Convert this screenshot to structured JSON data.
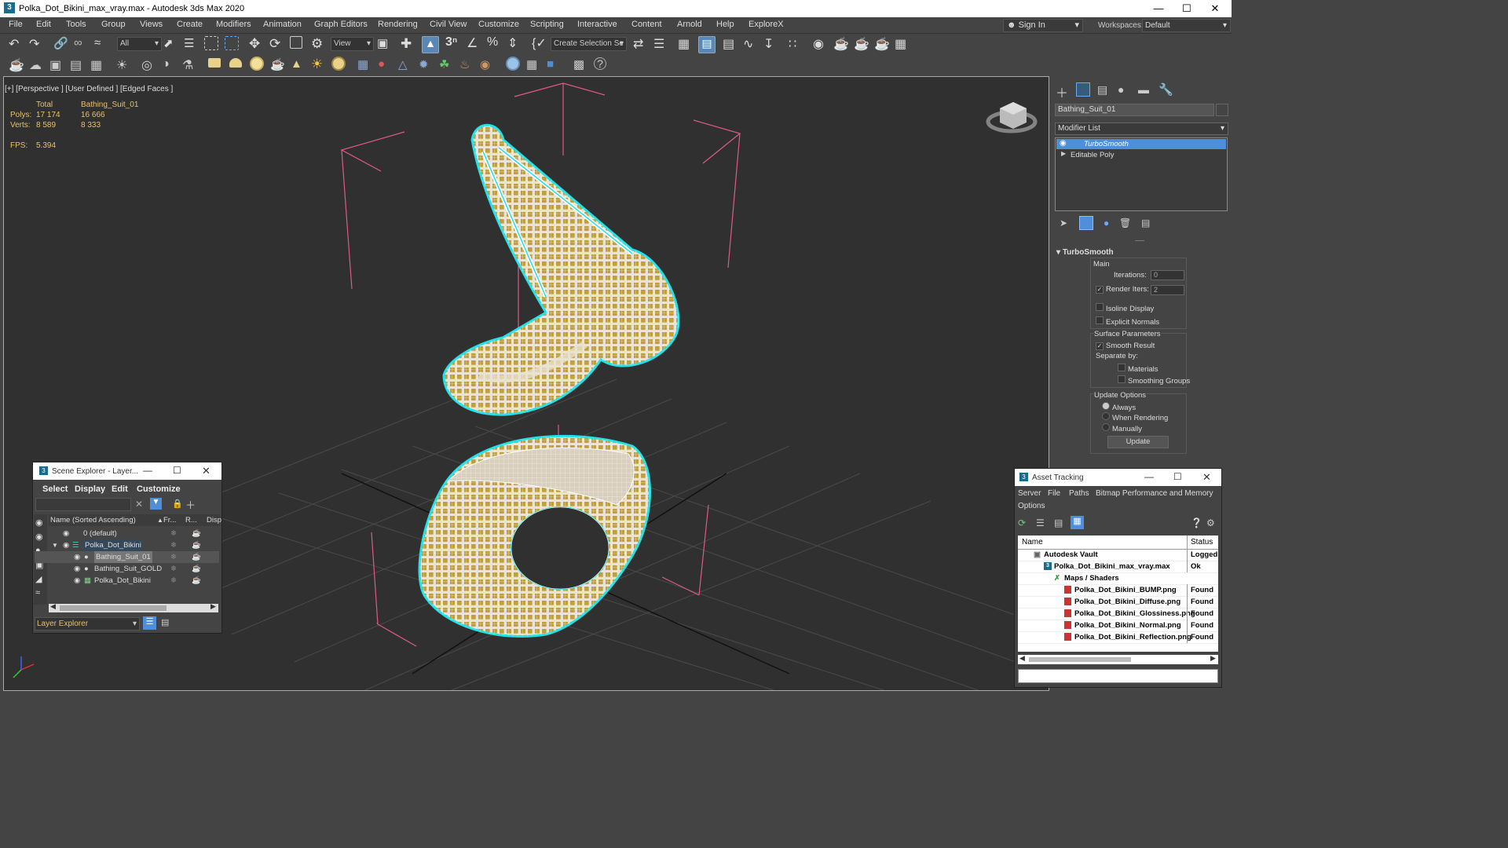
{
  "window": {
    "title": "Polka_Dot_Bikini_max_vray.max - Autodesk 3ds Max 2020",
    "app_icon": "3",
    "controls": [
      "minimize-icon",
      "maximize-icon",
      "close-icon"
    ]
  },
  "menu": {
    "items": [
      "File",
      "Edit",
      "Tools",
      "Group",
      "Views",
      "Create",
      "Modifiers",
      "Animation",
      "Graph Editors",
      "Rendering",
      "Civil View",
      "Customize",
      "Scripting",
      "Interactive",
      "Content",
      "Arnold",
      "Help",
      "ExploreX"
    ],
    "sign_in": "Sign In",
    "workspaces_label": "Workspaces:",
    "workspace_value": "Default"
  },
  "toolbar": {
    "filter_value": "All",
    "refcoord_value": "View",
    "selection_set_placeholder": "Create Selection Se"
  },
  "viewport": {
    "label": "[+] [Perspective ] [User Defined ] [Edged Faces ]",
    "stats": {
      "total_header": "Total",
      "object_header": "Bathing_Suit_01",
      "polys_label": "Polys:",
      "polys_total": "17 174",
      "polys_object": "16 666",
      "verts_label": "Verts:",
      "verts_total": "8 589",
      "verts_object": "8 333",
      "fps_label": "FPS:",
      "fps_value": "5.394"
    }
  },
  "command_panel": {
    "object_name": "Bathing_Suit_01",
    "modifier_list_label": "Modifier List",
    "stack": [
      "TurboSmooth",
      "Editable Poly"
    ],
    "rollout_title": "TurboSmooth",
    "main_label": "Main",
    "iterations_label": "Iterations:",
    "iterations_value": "0",
    "render_iters_label": "Render Iters:",
    "render_iters_value": "2",
    "render_iters_checked": true,
    "isoline_label": "Isoline Display",
    "explicit_normals_label": "Explicit Normals",
    "surface_params_label": "Surface Parameters",
    "smooth_result_label": "Smooth Result",
    "separate_by_label": "Separate by:",
    "materials_label": "Materials",
    "smoothing_groups_label": "Smoothing Groups",
    "update_options_label": "Update Options",
    "always_label": "Always",
    "when_rendering_label": "When Rendering",
    "manually_label": "Manually",
    "update_button": "Update"
  },
  "scene_explorer": {
    "title": "Scene Explorer - Layer...",
    "menu": [
      "Select",
      "Display",
      "Edit",
      "Customize"
    ],
    "col_name": "Name (Sorted Ascending)",
    "col_freeze": "Fr...",
    "col_render": "R...",
    "col_display": "Disp",
    "rows": [
      {
        "name": "0 (default)",
        "indent": 0
      },
      {
        "name": "Polka_Dot_Bikini",
        "indent": 0
      },
      {
        "name": "Bathing_Suit_01",
        "indent": 1
      },
      {
        "name": "Bathing_Suit_GOLD",
        "indent": 1
      },
      {
        "name": "Polka_Dot_Bikini",
        "indent": 1
      }
    ],
    "footer_value": "Layer Explorer"
  },
  "asset_tracking": {
    "title": "Asset Tracking",
    "menu": [
      "Server",
      "File",
      "Paths",
      "Bitmap Performance and Memory",
      "Options"
    ],
    "col_name": "Name",
    "col_status": "Status",
    "rows": [
      {
        "name": "Autodesk Vault",
        "status": "Logged O"
      },
      {
        "name": "Polka_Dot_Bikini_max_vray.max",
        "status": "Ok"
      },
      {
        "name": "Maps / Shaders",
        "status": ""
      },
      {
        "name": "Polka_Dot_Bikini_BUMP.png",
        "status": "Found"
      },
      {
        "name": "Polka_Dot_Bikini_Diffuse.png",
        "status": "Found"
      },
      {
        "name": "Polka_Dot_Bikini_Glossiness.png",
        "status": "Found"
      },
      {
        "name": "Polka_Dot_Bikini_Normal.png",
        "status": "Found"
      },
      {
        "name": "Polka_Dot_Bikini_Reflection.png",
        "status": "Found"
      }
    ]
  },
  "colors": {
    "accent_blue": "#4f8fd9",
    "selection_cyan": "#22e0e6",
    "stat_yellow": "#e7c16a",
    "bbox_pink": "#e05a88",
    "mesh_gold": "#bfa040"
  }
}
